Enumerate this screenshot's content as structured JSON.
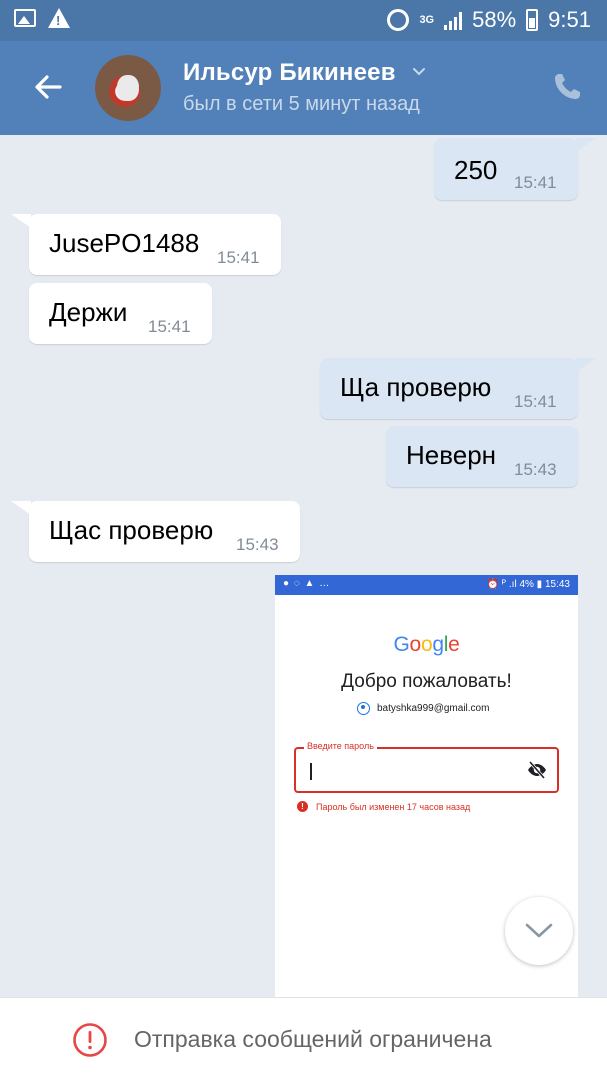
{
  "statusbar": {
    "network": "3G",
    "battery": "58%",
    "time": "9:51",
    "icons": [
      "image-icon",
      "warning-icon",
      "alarm-icon",
      "signal-icon",
      "battery-icon"
    ]
  },
  "header": {
    "name": "Ильсур Бикинеев",
    "status": "был в сети 5 минут назад",
    "icons": [
      "back-arrow-icon",
      "chevron-down-icon",
      "phone-icon"
    ]
  },
  "messages": [
    {
      "direction": "out",
      "text": "250",
      "time": "15:41"
    },
    {
      "direction": "in",
      "text": "JusePO1488",
      "time": "15:41"
    },
    {
      "direction": "in",
      "text": "Держи",
      "time": "15:41"
    },
    {
      "direction": "out",
      "text": "Ща проверю",
      "time": "15:41"
    },
    {
      "direction": "out",
      "text": "Неверн",
      "time": "15:43"
    },
    {
      "direction": "in",
      "text": "Щас проверю",
      "time": "15:43"
    }
  ],
  "attachment": {
    "statusbar_left": "● ◌ ▲ …",
    "statusbar_right": "⏰ ᴾ .ıl 4% ▮ 15:43",
    "google_letters": [
      {
        "char": "G",
        "color": "#4285F4"
      },
      {
        "char": "o",
        "color": "#EA4335"
      },
      {
        "char": "o",
        "color": "#FBBC05"
      },
      {
        "char": "g",
        "color": "#4285F4"
      },
      {
        "char": "l",
        "color": "#34A853"
      },
      {
        "char": "e",
        "color": "#EA4335"
      }
    ],
    "welcome": "Добро пожаловать!",
    "email": "batyshka999@gmail.com",
    "password_label": "Введите пароль",
    "error": "Пароль был изменен 17 часов назад"
  },
  "bottom": {
    "text": "Отправка сообщений ограничена"
  },
  "colors": {
    "header": "#5181b8",
    "statusbar": "#4a76a8",
    "background": "#e6ebf1",
    "outgoing_bubble": "#dae6f4",
    "incoming_bubble": "#ffffff",
    "error": "#d93025",
    "limit_icon": "#e64646"
  }
}
